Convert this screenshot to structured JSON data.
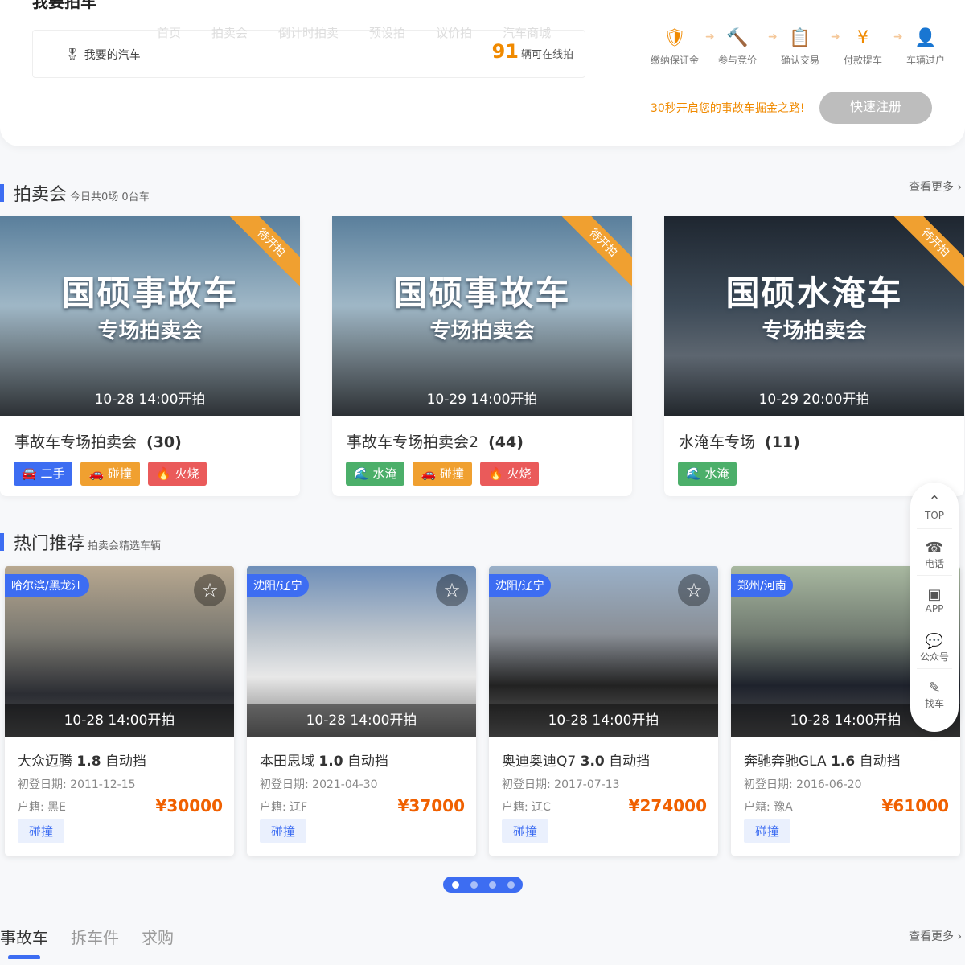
{
  "header": {
    "brand": "我要拍车",
    "nav": [
      "首页",
      "拍卖会",
      "倒计时拍卖",
      "预设拍",
      "议价拍",
      "汽车商城"
    ],
    "my_car": "我要的汽车",
    "count": "91",
    "count_suffix": "辆可在线拍",
    "steps": [
      {
        "icon": "shield-yen-icon",
        "label": "缴纳保证金"
      },
      {
        "icon": "gavel-icon",
        "label": "参与竞价"
      },
      {
        "icon": "clipboard-check-icon",
        "label": "确认交易"
      },
      {
        "icon": "car-yen-icon",
        "label": "付款提车"
      },
      {
        "icon": "user-transfer-icon",
        "label": "车辆过户"
      }
    ],
    "promo": "30秒开启您的事故车掘金之路!",
    "register": "快速注册"
  },
  "auction": {
    "title": "拍卖会",
    "subtitle": "今日共0场 0台车",
    "more": "查看更多 ›",
    "cards": [
      {
        "banner_title": "国硕事故车",
        "banner_sub": "专场拍卖会",
        "ribbon": "待开拍",
        "time": "10-28 14:00开拍",
        "name": "事故车专场拍卖会",
        "count": "(30)",
        "tags": [
          {
            "label": "二手",
            "color": "#3d6df2",
            "icon": "car-front-icon"
          },
          {
            "label": "碰撞",
            "color": "#f0a030",
            "icon": "car-crash-icon"
          },
          {
            "label": "火烧",
            "color": "#ea5a5a",
            "icon": "car-fire-icon"
          }
        ]
      },
      {
        "banner_title": "国硕事故车",
        "banner_sub": "专场拍卖会",
        "ribbon": "待开拍",
        "time": "10-29 14:00开拍",
        "name": "事故车专场拍卖会2",
        "count": "(44)",
        "tags": [
          {
            "label": "水淹",
            "color": "#4caf6a",
            "icon": "car-flood-icon"
          },
          {
            "label": "碰撞",
            "color": "#f0a030",
            "icon": "car-crash-icon"
          },
          {
            "label": "火烧",
            "color": "#ea5a5a",
            "icon": "car-fire-icon"
          }
        ]
      },
      {
        "banner_title": "国硕水淹车",
        "banner_sub": "专场拍卖会",
        "ribbon": "待开拍",
        "time": "10-29 20:00开拍",
        "name": "水淹车专场",
        "count": "(11)",
        "tags": [
          {
            "label": "水淹",
            "color": "#4caf6a",
            "icon": "car-flood-icon"
          }
        ]
      }
    ]
  },
  "hot": {
    "title": "热门推荐",
    "subtitle": "拍卖会精选车辆",
    "cards": [
      {
        "loc": "哈尔滨/黑龙江",
        "time": "10-28 14:00开拍",
        "brand": "大众迈腾",
        "disp": "1.8",
        "trans": "自动挡",
        "date": "初登日期: 2011-12-15",
        "reg": "户籍: 黑E",
        "price": "¥30000",
        "tag": "碰撞"
      },
      {
        "loc": "沈阳/辽宁",
        "time": "10-28 14:00开拍",
        "brand": "本田思域",
        "disp": "1.0",
        "trans": "自动挡",
        "date": "初登日期: 2021-04-30",
        "reg": "户籍: 辽F",
        "price": "¥37000",
        "tag": "碰撞"
      },
      {
        "loc": "沈阳/辽宁",
        "time": "10-28 14:00开拍",
        "brand": "奥迪奥迪Q7",
        "disp": "3.0",
        "trans": "自动挡",
        "date": "初登日期: 2017-07-13",
        "reg": "户籍: 辽C",
        "price": "¥274000",
        "tag": "碰撞"
      },
      {
        "loc": "郑州/河南",
        "time": "10-28 14:00开拍",
        "brand": "奔驰奔驰GLA",
        "disp": "1.6",
        "trans": "自动挡",
        "date": "初登日期: 2016-06-20",
        "reg": "户籍: 豫A",
        "price": "¥61000",
        "tag": "碰撞"
      }
    ]
  },
  "side": [
    {
      "icon": "arrow-top-icon",
      "label": "TOP"
    },
    {
      "icon": "phone-icon",
      "label": "电话"
    },
    {
      "icon": "app-icon",
      "label": "APP"
    },
    {
      "icon": "wechat-icon",
      "label": "公众号"
    },
    {
      "icon": "edit-icon",
      "label": "找车"
    }
  ],
  "pagination": {
    "pages": 4,
    "current": 1
  },
  "bottom_tabs": [
    "事故车",
    "拆车件",
    "求购"
  ],
  "bottom_more": "查看更多 ›"
}
